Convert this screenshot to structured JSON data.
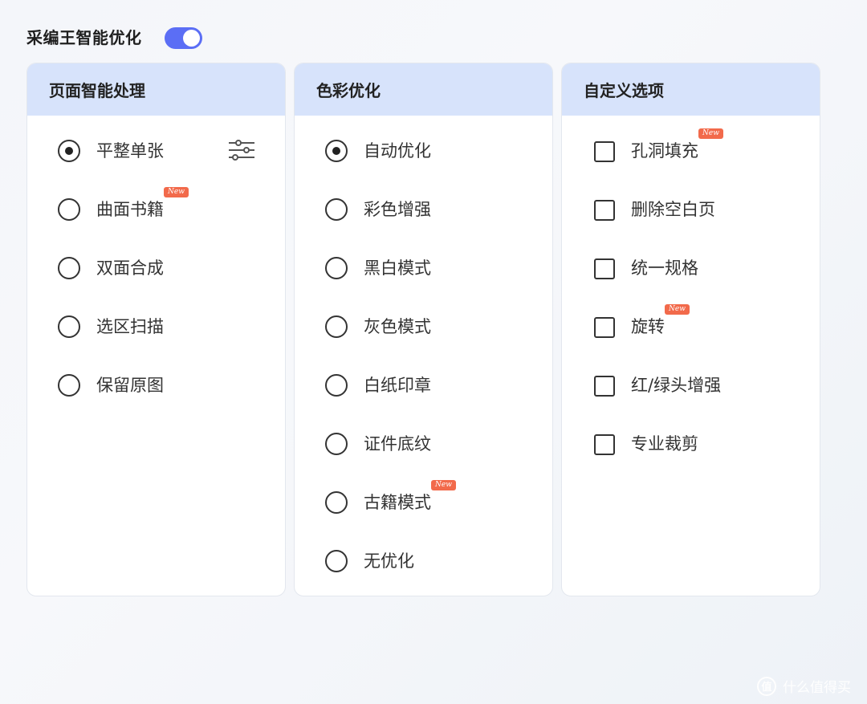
{
  "header": {
    "title": "采编王智能优化",
    "toggle_on": true,
    "accent_color": "#5b6ef5"
  },
  "panels": [
    {
      "title": "页面智能处理",
      "type": "radio",
      "options": [
        {
          "label": "平整单张",
          "selected": true,
          "has_settings": true
        },
        {
          "label": "曲面书籍",
          "badge": "New"
        },
        {
          "label": "双面合成"
        },
        {
          "label": "选区扫描"
        },
        {
          "label": "保留原图"
        }
      ]
    },
    {
      "title": "色彩优化",
      "type": "radio",
      "options": [
        {
          "label": "自动优化",
          "selected": true
        },
        {
          "label": "彩色增强"
        },
        {
          "label": "黑白模式"
        },
        {
          "label": "灰色模式"
        },
        {
          "label": "白纸印章"
        },
        {
          "label": "证件底纹"
        },
        {
          "label": "古籍模式",
          "badge": "New"
        },
        {
          "label": "无优化"
        }
      ]
    },
    {
      "title": "自定义选项",
      "type": "checkbox",
      "options": [
        {
          "label": "孔洞填充",
          "badge": "New"
        },
        {
          "label": "删除空白页"
        },
        {
          "label": "统一规格"
        },
        {
          "label": "旋转",
          "badge": "New"
        },
        {
          "label": "红/绿头增强"
        },
        {
          "label": "专业裁剪"
        }
      ]
    }
  ],
  "badge_color": "#f26a4b",
  "header_bg_color": "#d7e3fb",
  "watermark": {
    "icon": "值",
    "text": "什么值得买"
  }
}
